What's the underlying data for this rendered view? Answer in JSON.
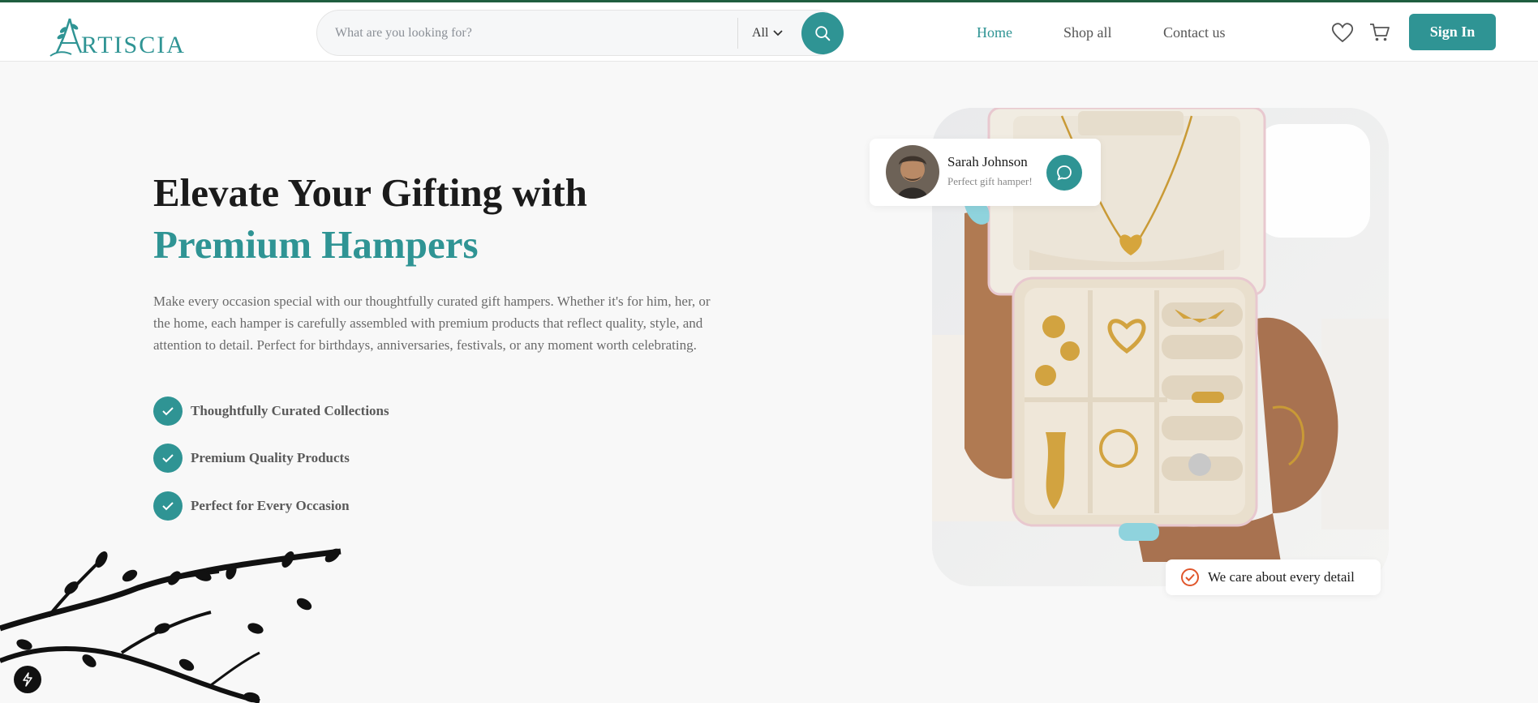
{
  "brand": {
    "name": "ARTISCIA",
    "initial": "A",
    "rest": "RTISCIA",
    "color": "#2f9494"
  },
  "search": {
    "placeholder": "What are you looking for?",
    "category": "All",
    "button_icon": "search-icon"
  },
  "nav": {
    "home": "Home",
    "shop_all": "Shop all",
    "contact_us": "Contact us"
  },
  "header_icons": {
    "wishlist": "heart-icon",
    "cart": "cart-icon"
  },
  "auth": {
    "sign_in": "Sign In"
  },
  "hero": {
    "title_line1": "Elevate Your Gifting with",
    "title_line2": "Premium Hampers",
    "description": "Make every occasion special with our thoughtfully curated gift hampers. Whether it's for him, her, or the home, each hamper is carefully assembled with premium products that reflect quality, style, and attention to detail. Perfect for birthdays, anniversaries, festivals, or any moment worth celebrating.",
    "features": [
      "Thoughtfully Curated Collections",
      "Premium Quality Products",
      "Perfect for Every Occasion"
    ]
  },
  "review": {
    "name": "Sarah Johnson",
    "message": "Perfect gift hamper!",
    "action_icon": "chat-icon"
  },
  "care_badge": {
    "text": "We care about every detail",
    "icon": "check-circle-icon"
  },
  "colors": {
    "accent": "#2f9494",
    "heading": "#1b1b1b",
    "care_icon": "#e0562b",
    "top_border": "#1f5e3f"
  }
}
